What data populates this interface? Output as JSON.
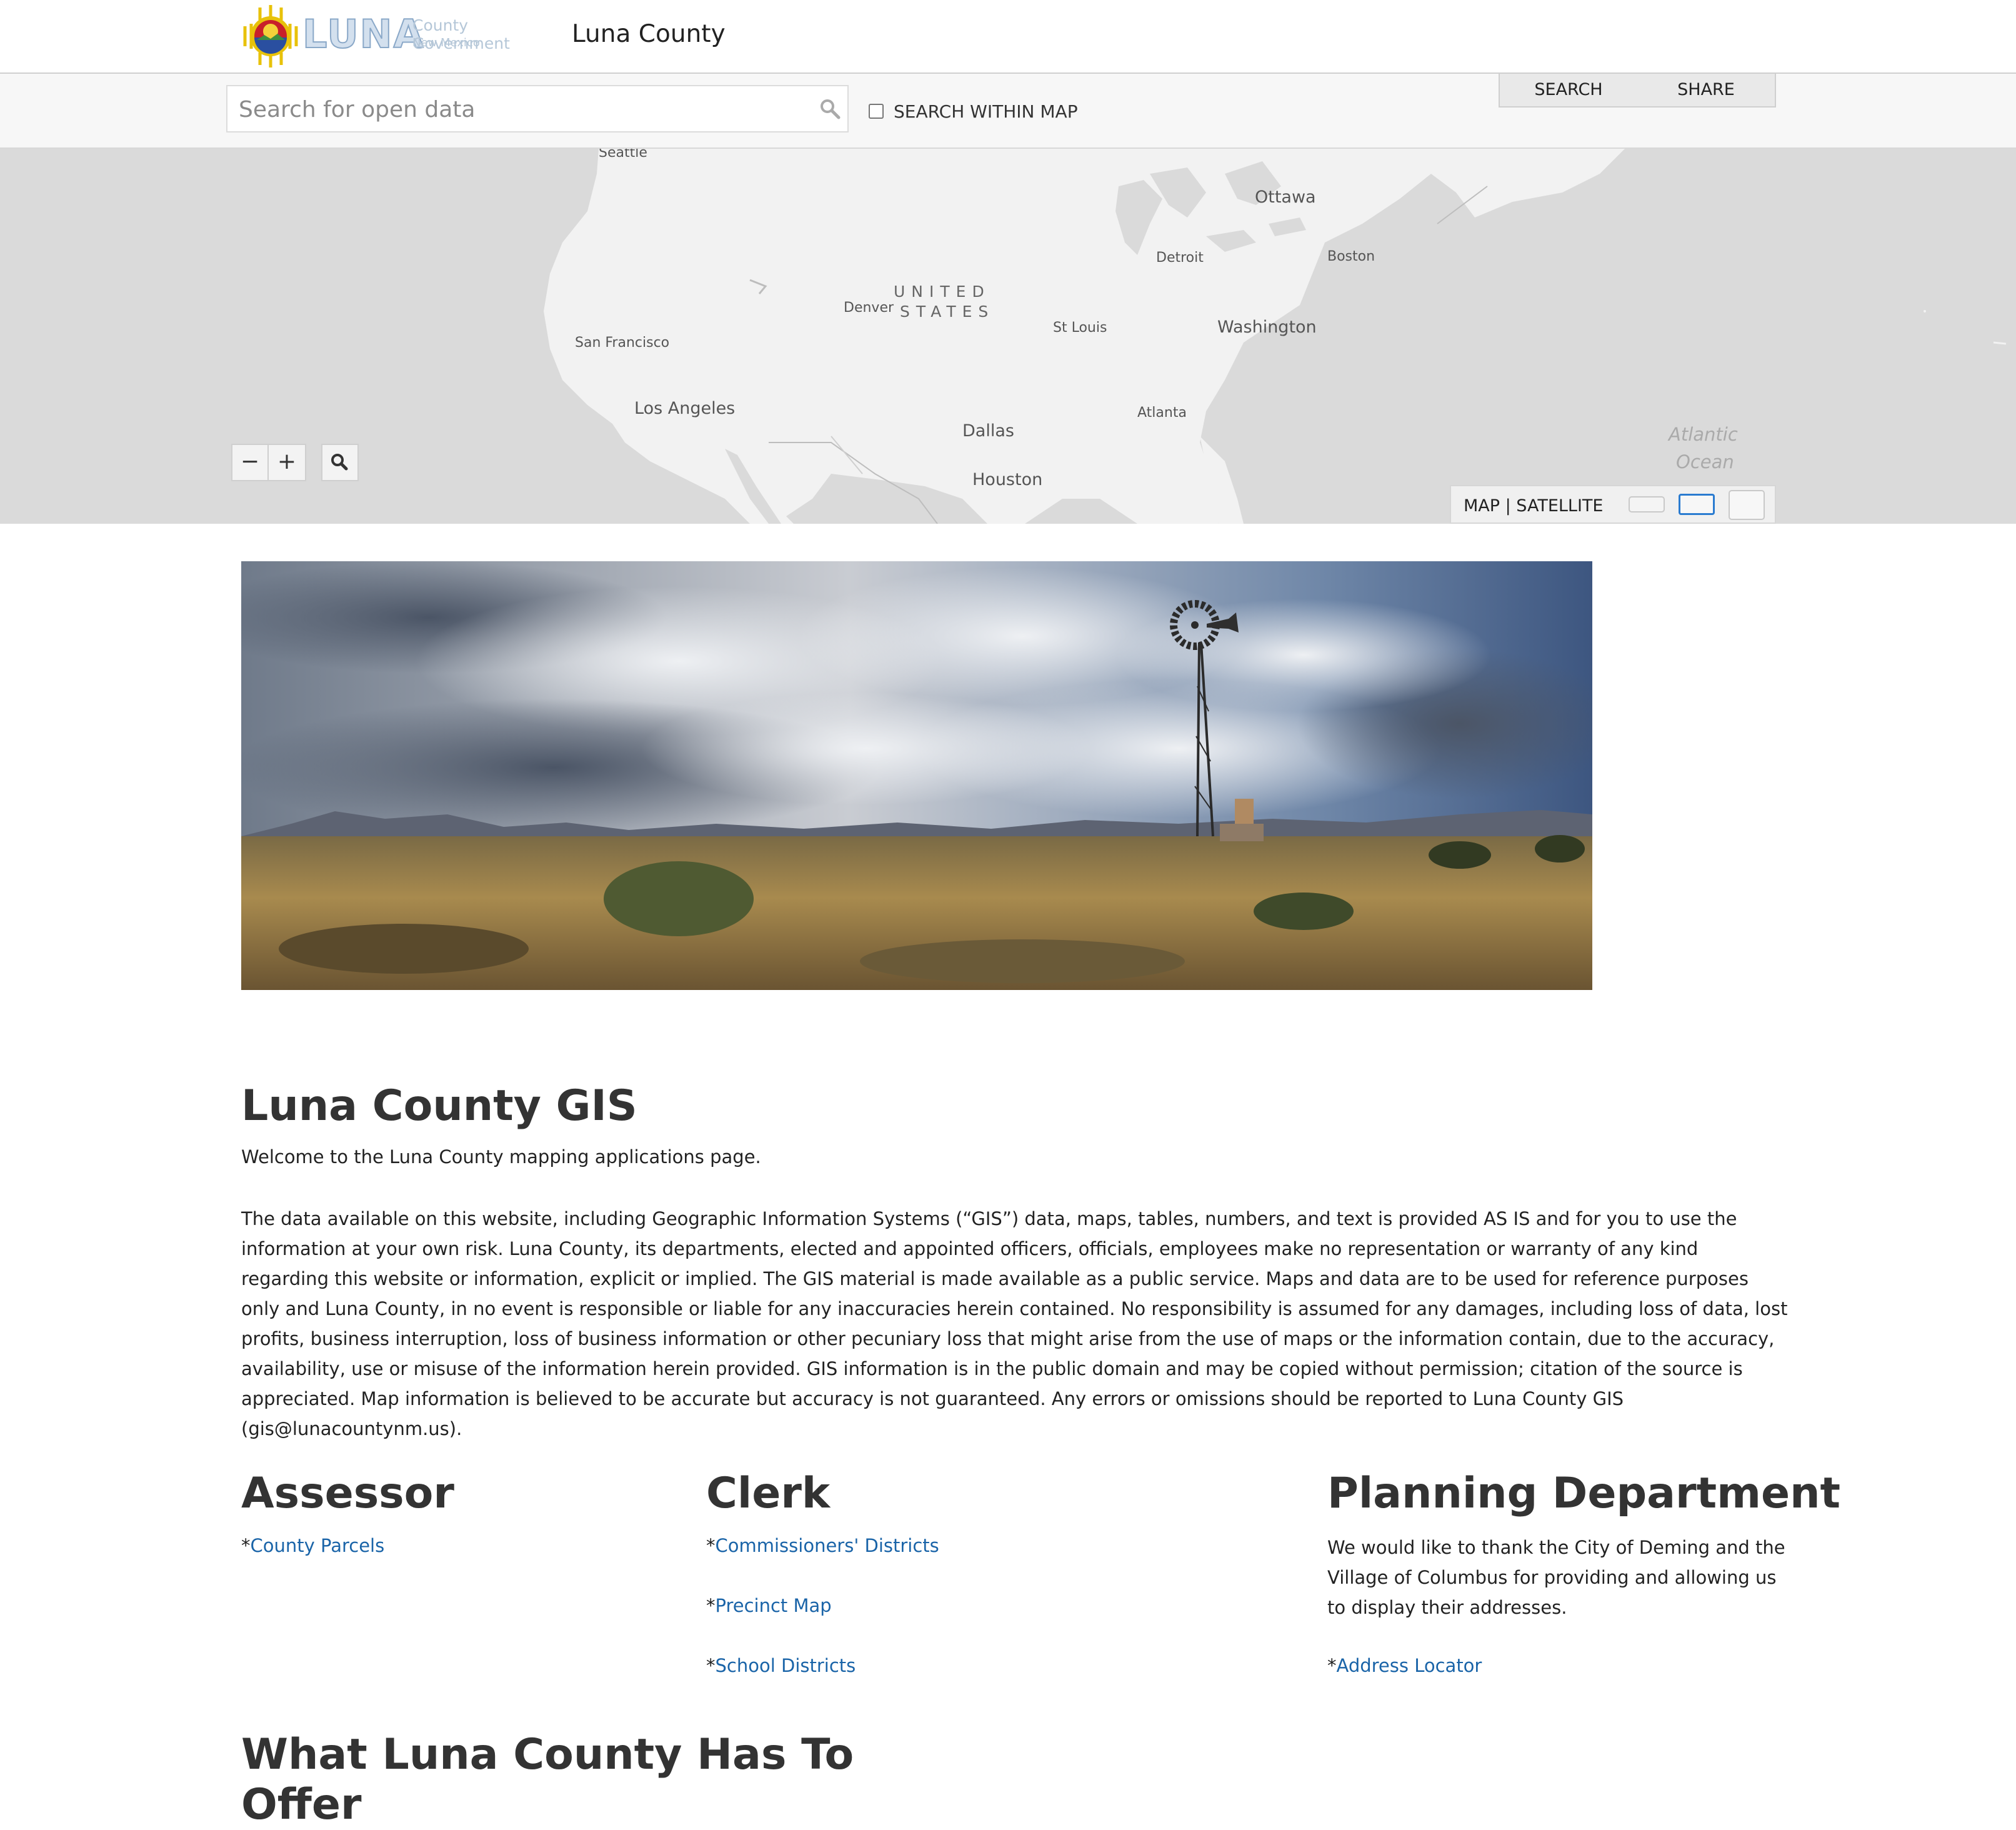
{
  "header": {
    "logo_main": "LUNA",
    "logo_sub1": "County Government",
    "logo_sub2": "New Mexico",
    "site_title": "Luna County"
  },
  "search": {
    "placeholder": "Search for open data",
    "within_map_label": "SEARCH WITHIN MAP"
  },
  "tabs": {
    "search_label": "SEARCH",
    "share_label": "SHARE"
  },
  "map": {
    "labels": {
      "seattle": "Seattle",
      "ottawa": "Ottawa",
      "detroit": "Detroit",
      "boston": "Boston",
      "united": "UNITED",
      "states": "STATES",
      "denver": "Denver",
      "st_louis": "St Louis",
      "washington": "Washington",
      "san_francisco": "San Francisco",
      "los_angeles": "Los Angeles",
      "dallas": "Dallas",
      "atlanta": "Atlanta",
      "houston": "Houston",
      "atlantic": "Atlantic",
      "ocean": "Ocean"
    },
    "zoom_out_label": "−",
    "zoom_in_label": "+",
    "basemap_toggle_label": "MAP | SATELLITE",
    "colors": {
      "water": "#dadada",
      "land": "#f2f2f2",
      "active_thumb": "#2a7bd0"
    },
    "icons": {
      "locate": "magnifier-icon",
      "search": "search-icon"
    }
  },
  "main": {
    "title": "Luna County GIS",
    "welcome": "Welcome to the Luna County mapping applications page.",
    "disclaimer": "The data available on this website, including Geographic Information Systems (“GIS”) data, maps, tables, numbers, and text is provided AS IS and for you to use the information at your own risk. Luna County, its departments, elected and appointed officers, officials, employees make no representation or warranty of any kind regarding this website or information, explicit or implied. The GIS material is made available as a public service. Maps and data are to be used for reference purposes only and Luna County, in no event is responsible or liable for any inaccuracies herein contained. No responsibility is assumed for any damages, including loss of data, lost profits, business interruption, loss of business information or other pecuniary loss that might arise from the use of maps or the information contain, due to the accuracy, availability, use or misuse of the information herein provided. GIS information is in the public domain and may be copied without permission; citation of the source is appreciated. Map information is believed to be accurate but accuracy is not guaranteed. Any errors or omissions should be reported to Luna County GIS (gis@lunacountynm.us).",
    "bullet": "*",
    "assessor": {
      "title": "Assessor",
      "links": [
        "County Parcels"
      ]
    },
    "clerk": {
      "title": "Clerk",
      "links": [
        "Commissioners' Districts",
        "Precinct Map",
        "School Districts"
      ]
    },
    "planning": {
      "title": "Planning Department",
      "text": "We would like to thank the City of Deming and the Village of Columbus for providing and allowing us to display their addresses.",
      "links": [
        "Address Locator"
      ]
    },
    "offer_title": "What Luna County Has To Offer"
  },
  "colors": {
    "link": "#1a64a8",
    "heading": "#333333"
  }
}
